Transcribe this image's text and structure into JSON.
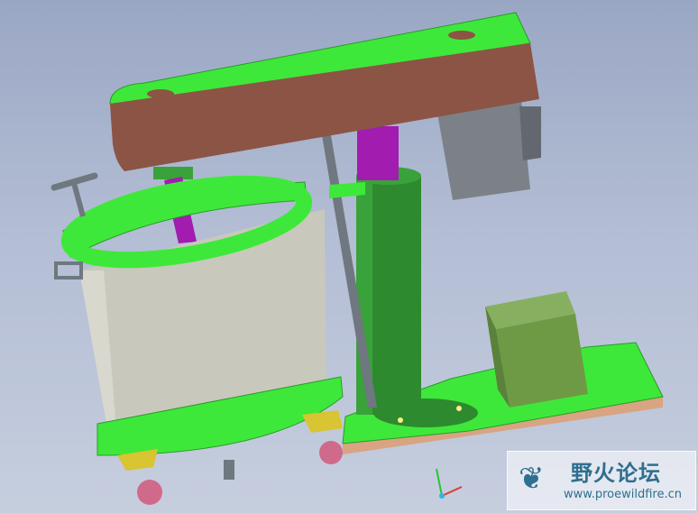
{
  "scene": {
    "kind": "3D CAD model render",
    "subject": "lifting high-speed disperser with mixing tank",
    "background_colors": [
      "#9aa7c4",
      "#c6cede"
    ],
    "part_colors": {
      "rim_green": "#3ee83a",
      "rim_dark": "#26a422",
      "beam_side": "#8c5445",
      "shaft_purple": "#a21cb0",
      "column_green": "#2e8a2e",
      "motor_gray": "#7c8188",
      "tank_gray": "#c9c8bd",
      "control_box": "#6f9a45",
      "caster_yellow": "#d9c431",
      "wheel_pink": "#d06a8a"
    }
  },
  "watermark": {
    "title": "野火论坛",
    "url": "www.proewildfire.cn"
  },
  "axis_triad": [
    "x-axis",
    "y-axis",
    "z-axis"
  ]
}
